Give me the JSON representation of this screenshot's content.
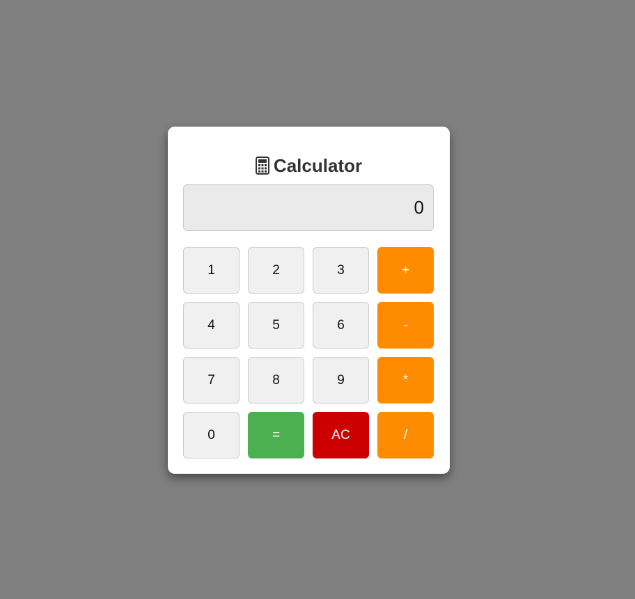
{
  "app": {
    "title": "Calculator",
    "icon": "calculator-icon"
  },
  "display": {
    "value": "0"
  },
  "keys": [
    {
      "label": "1",
      "kind": "digit"
    },
    {
      "label": "2",
      "kind": "digit"
    },
    {
      "label": "3",
      "kind": "digit"
    },
    {
      "label": "+",
      "kind": "op"
    },
    {
      "label": "4",
      "kind": "digit"
    },
    {
      "label": "5",
      "kind": "digit"
    },
    {
      "label": "6",
      "kind": "digit"
    },
    {
      "label": "-",
      "kind": "op"
    },
    {
      "label": "7",
      "kind": "digit"
    },
    {
      "label": "8",
      "kind": "digit"
    },
    {
      "label": "9",
      "kind": "digit"
    },
    {
      "label": "*",
      "kind": "op"
    },
    {
      "label": "0",
      "kind": "digit"
    },
    {
      "label": "=",
      "kind": "eq"
    },
    {
      "label": "AC",
      "kind": "clear"
    },
    {
      "label": "/",
      "kind": "op"
    }
  ],
  "colors": {
    "background": "#808080",
    "card": "#ffffff",
    "digit": "#f0f0f0",
    "operator": "#ff8c00",
    "equals": "#4caf50",
    "clear": "#cc0000"
  }
}
